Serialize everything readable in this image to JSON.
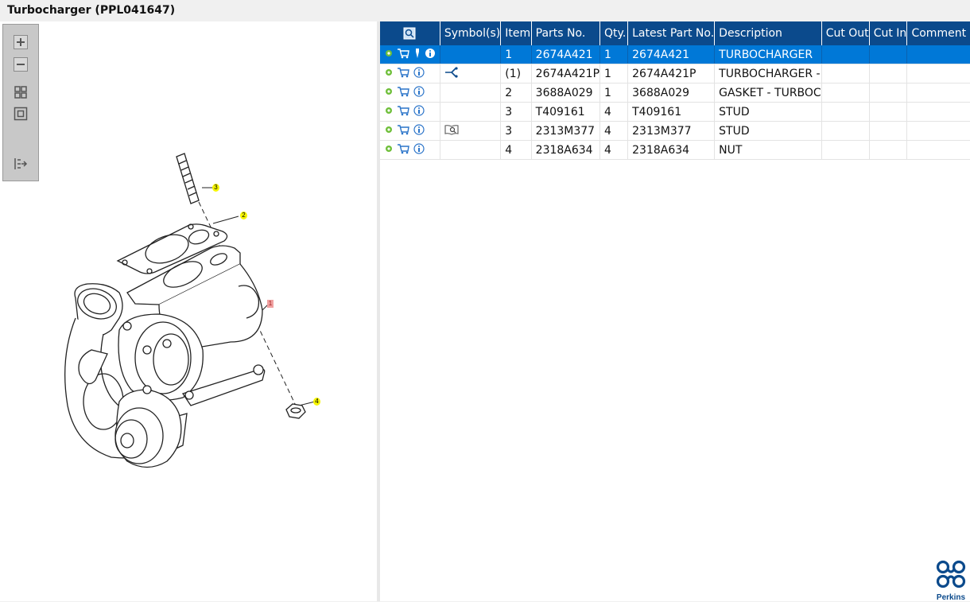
{
  "window": {
    "title": "Turbocharger (PPL041647)"
  },
  "toolbox": {
    "tools": [
      {
        "name": "zoom-in-icon"
      },
      {
        "name": "zoom-out-icon"
      },
      {
        "name": "fit-all-icon"
      },
      {
        "name": "fit-window-icon"
      },
      {
        "name": "export-icon"
      }
    ]
  },
  "diagram": {
    "callouts": [
      {
        "label": "3",
        "kind": "yellow"
      },
      {
        "label": "2",
        "kind": "yellow"
      },
      {
        "label": "1",
        "kind": "red"
      },
      {
        "label": "4",
        "kind": "yellow"
      }
    ]
  },
  "table": {
    "columns": [
      "",
      "Symbol(s)",
      "Item",
      "Parts No.",
      "Qty.",
      "Latest Part No.",
      "Description",
      "Cut Out",
      "Cut In",
      "Comment"
    ],
    "rows": [
      {
        "item": "1",
        "part": "2674A421",
        "qty": "1",
        "latest": "2674A421",
        "desc": "TURBOCHARGER",
        "cutout": "",
        "cutin": "",
        "comment": "",
        "symbol": "",
        "selected": true
      },
      {
        "item": "(1)",
        "part": "2674A421P",
        "qty": "1",
        "latest": "2674A421P",
        "desc": "TURBOCHARGER -",
        "cutout": "",
        "cutin": "",
        "comment": "",
        "symbol": "split-icon",
        "selected": false
      },
      {
        "item": "2",
        "part": "3688A029",
        "qty": "1",
        "latest": "3688A029",
        "desc": "GASKET - TURBOC",
        "cutout": "",
        "cutin": "",
        "comment": "",
        "symbol": "",
        "selected": false
      },
      {
        "item": "3",
        "part": "T409161",
        "qty": "4",
        "latest": "T409161",
        "desc": "STUD",
        "cutout": "",
        "cutin": "",
        "comment": "",
        "symbol": "",
        "selected": false
      },
      {
        "item": "3",
        "part": "2313M377",
        "qty": "4",
        "latest": "2313M377",
        "desc": "STUD",
        "cutout": "",
        "cutin": "",
        "comment": "",
        "symbol": "book-search-icon",
        "selected": false
      },
      {
        "item": "4",
        "part": "2318A634",
        "qty": "4",
        "latest": "2318A634",
        "desc": "NUT",
        "cutout": "",
        "cutin": "",
        "comment": "",
        "symbol": "",
        "selected": false
      }
    ]
  },
  "brand": {
    "name": "Perkins",
    "color": "#0b4a8c"
  },
  "colors": {
    "header": "#0b4a8c",
    "selected": "#0078d7",
    "callout_yellow": "#f5f500",
    "callout_red": "#f0a0a0"
  }
}
